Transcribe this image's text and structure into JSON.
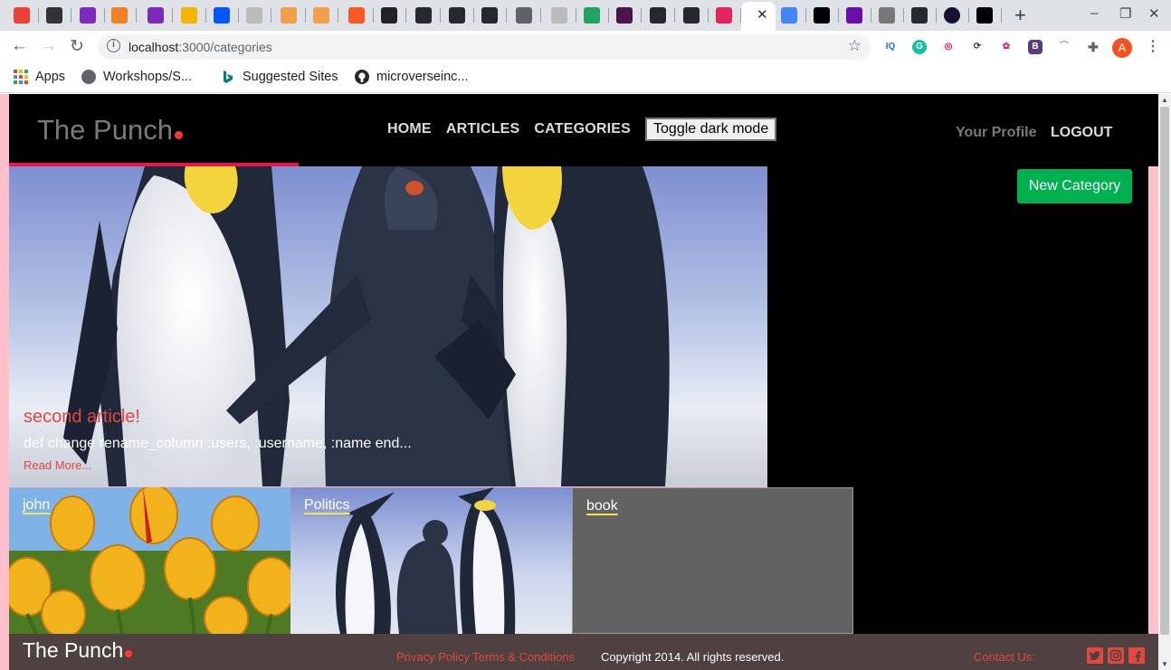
{
  "browser": {
    "tab_count": 30,
    "active_tab_close": "✕",
    "new_tab": "+",
    "window_controls": [
      "–",
      "❐",
      "✕"
    ],
    "url_host": "localhost",
    "url_path": ":3000/categories",
    "bookmarks": [
      {
        "label": "Apps"
      },
      {
        "label": "Workshops/S..."
      },
      {
        "label": "Suggested Sites"
      },
      {
        "label": "microverseinc..."
      }
    ],
    "profile_initial": "A",
    "extensions": [
      "IQ",
      "G",
      "◎",
      "⟳",
      "✿",
      "B",
      "⌒",
      "✚"
    ]
  },
  "site": {
    "logo": "The Punch",
    "nav": {
      "home": "HOME",
      "articles": "ARTICLES",
      "categories": "CATEGORIES",
      "toggle": "Toggle dark mode"
    },
    "profile": "Your Profile",
    "logout": "LOGOUT",
    "new_category": "New Category"
  },
  "hero": {
    "title": "second article!",
    "excerpt": "def change rename_column :users, :username, :name end...",
    "read_more": "Read More..."
  },
  "categories": [
    {
      "label": "john",
      "image": "tulips"
    },
    {
      "label": "Politics",
      "image": "penguins"
    },
    {
      "label": "book",
      "image": "none"
    }
  ],
  "footer": {
    "logo": "The Punch",
    "links": "Privacy Policy Terms & Conditions",
    "copyright": "Copyright 2014. All rights reserved.",
    "contact": "Contact Us:",
    "social": [
      "twitter-icon",
      "instagram-icon",
      "facebook-icon"
    ]
  },
  "colors": {
    "accent_red": "#e2483d",
    "logo_bar": "#e8174b",
    "button_green": "#00b14f",
    "page_pink": "#ffc0cb",
    "footer_bg": "#4e4140"
  }
}
